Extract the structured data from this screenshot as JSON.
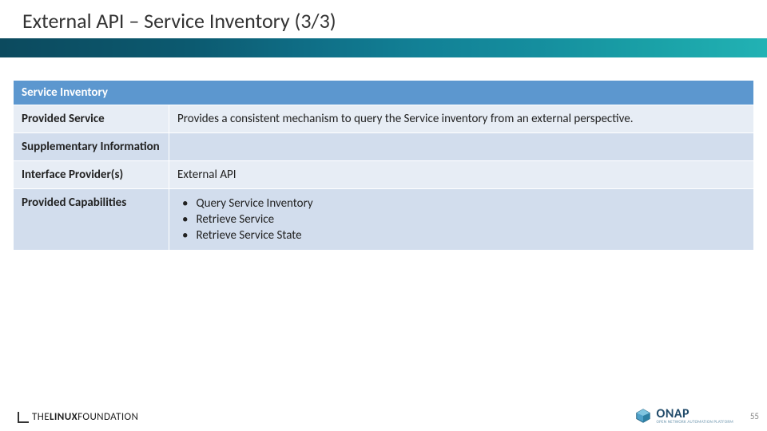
{
  "title": "External API – Service Inventory (3/3)",
  "table": {
    "header": "Service Inventory",
    "rows": {
      "provided_service": {
        "label": "Provided Service",
        "value": "Provides a consistent mechanism to query the Service inventory from an external perspective."
      },
      "supplementary_info": {
        "label": "Supplementary Information",
        "value": ""
      },
      "interface_providers": {
        "label": "Interface Provider(s)",
        "value": "External API"
      },
      "provided_capabilities": {
        "label": "Provided Capabilities",
        "items": [
          "Query Service Inventory",
          "Retrieve Service",
          "Retrieve Service State"
        ]
      }
    }
  },
  "footer": {
    "linux_foundation_prefix": "THE",
    "linux_foundation_bold": "LINUX",
    "linux_foundation_suffix": "FOUNDATION",
    "onap_label": "ONAP",
    "onap_sub": "OPEN NETWORK AUTOMATION PLATFORM",
    "page_number": "55"
  }
}
